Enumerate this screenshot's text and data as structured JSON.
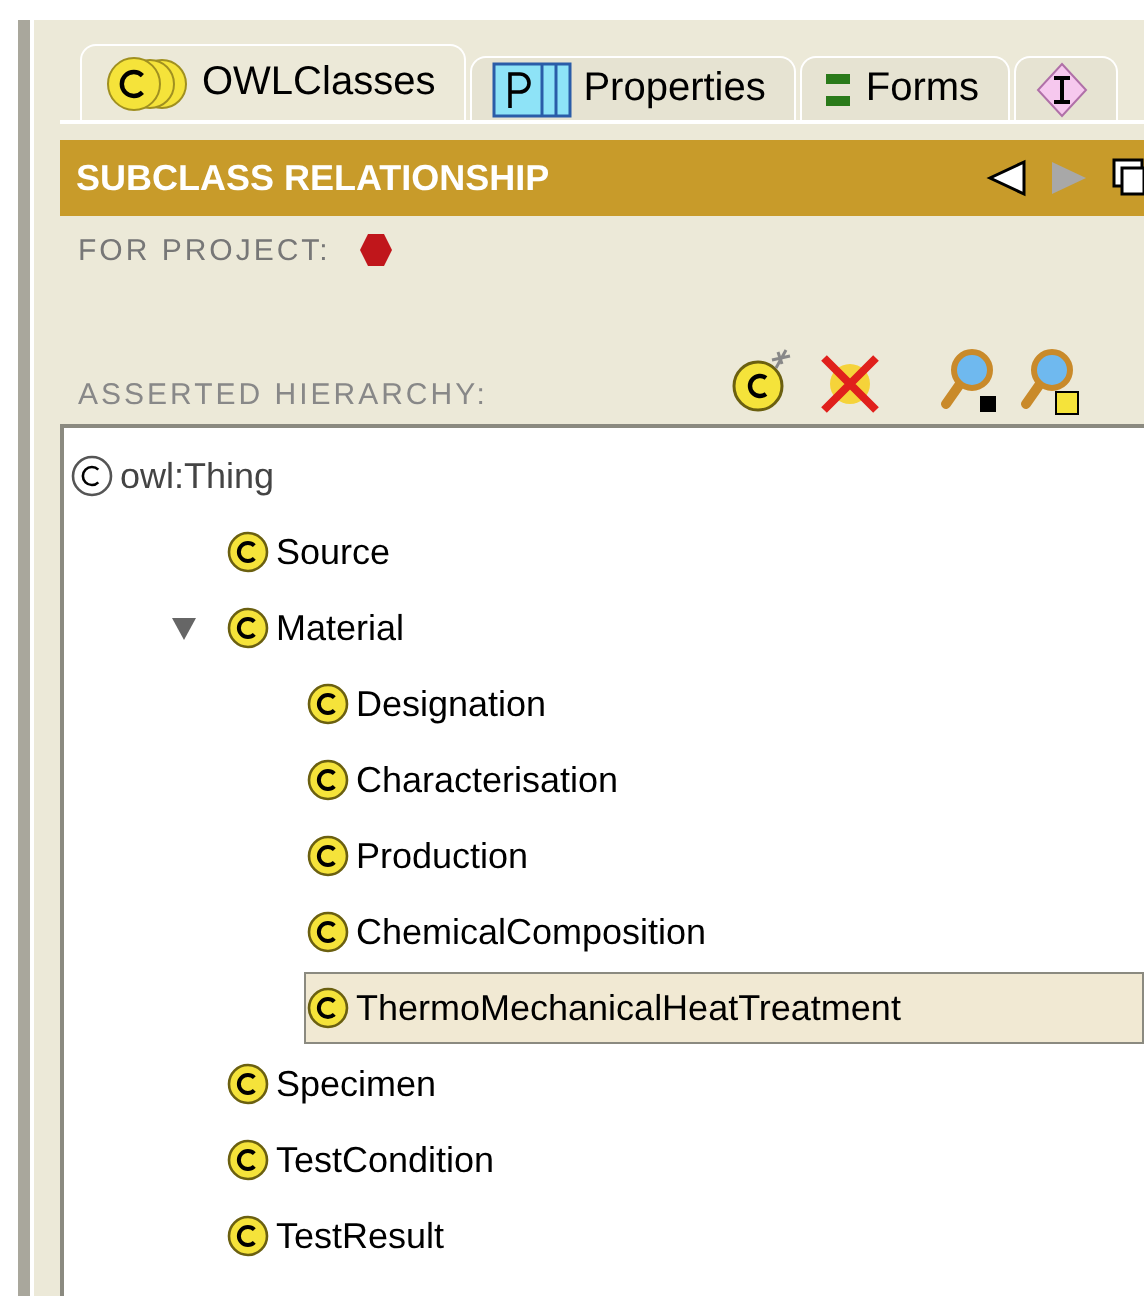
{
  "tabs": [
    {
      "label": "OWLClasses",
      "kind": "classes",
      "selected": true
    },
    {
      "label": "Properties",
      "kind": "properties",
      "selected": false
    },
    {
      "label": "Forms",
      "kind": "forms",
      "selected": false
    },
    {
      "kind": "individuals",
      "selected": false
    }
  ],
  "header": {
    "title": "SUBCLASS RELATIONSHIP"
  },
  "project": {
    "label": "FOR PROJECT:"
  },
  "hierarchy": {
    "label": "ASSERTED HIERARCHY:"
  },
  "tree": [
    {
      "label": "owl:Thing",
      "kind": "root",
      "selected": false,
      "children": [
        {
          "label": "Source",
          "kind": "class",
          "selected": false
        },
        {
          "label": "Material",
          "kind": "class",
          "expanded": true,
          "selected": false,
          "children": [
            {
              "label": "Designation",
              "kind": "class",
              "selected": false
            },
            {
              "label": "Characterisation",
              "kind": "class",
              "selected": false
            },
            {
              "label": "Production",
              "kind": "class",
              "selected": false
            },
            {
              "label": "ChemicalComposition",
              "kind": "class",
              "selected": false
            },
            {
              "label": "ThermoMechanicalHeatTreatment",
              "kind": "class",
              "selected": true
            }
          ]
        },
        {
          "label": "Specimen",
          "kind": "class",
          "selected": false
        },
        {
          "label": "TestCondition",
          "kind": "class",
          "selected": false
        },
        {
          "label": "TestResult",
          "kind": "class",
          "selected": false
        }
      ]
    }
  ]
}
